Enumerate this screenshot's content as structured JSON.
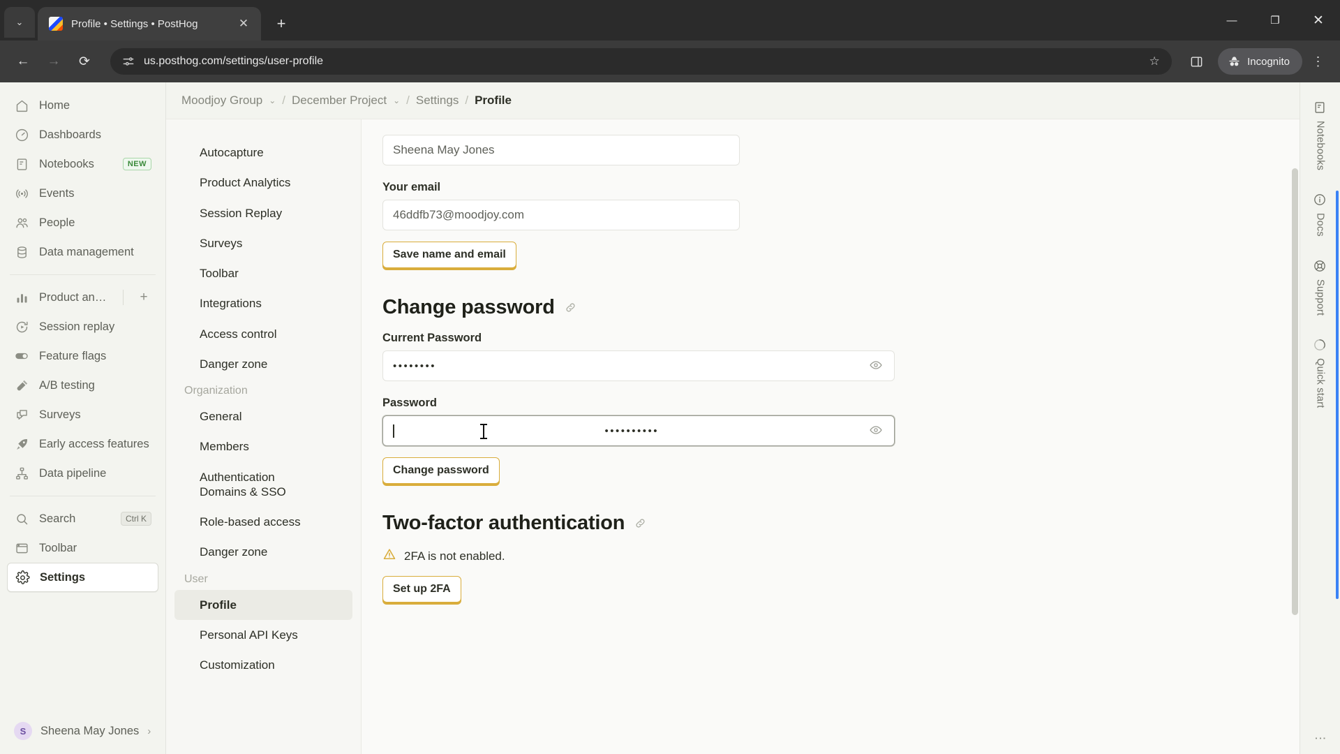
{
  "browser": {
    "tab": {
      "title": "Profile • Settings • PostHog",
      "favicon_name": "posthog-favicon",
      "close_label": "✕"
    },
    "new_tab_label": "+",
    "tab_list_chevron": "⌄",
    "window_controls": {
      "minimize": "—",
      "maximize": "❐",
      "close": "✕"
    },
    "nav": {
      "back": "←",
      "forward": "→",
      "reload": "⟳"
    },
    "omnibox": {
      "url": "us.posthog.com/settings/user-profile",
      "site_info_icon": "tune-icon",
      "star_label": "☆"
    },
    "side_panel_label": "side-panel",
    "incognito_label": "Incognito",
    "menu_label": "⋮"
  },
  "sidebar": {
    "primary": [
      {
        "label": "Home",
        "icon": "home-icon"
      },
      {
        "label": "Dashboards",
        "icon": "gauge-icon"
      },
      {
        "label": "Notebooks",
        "icon": "notebook-icon",
        "badge": "NEW"
      },
      {
        "label": "Events",
        "icon": "broadcast-icon"
      },
      {
        "label": "People",
        "icon": "people-icon"
      },
      {
        "label": "Data management",
        "icon": "database-icon"
      }
    ],
    "secondary": [
      {
        "label": "Product analytics",
        "icon": "bar-chart-icon",
        "has_plus": true
      },
      {
        "label": "Session replay",
        "icon": "replay-icon"
      },
      {
        "label": "Feature flags",
        "icon": "toggle-icon"
      },
      {
        "label": "A/B testing",
        "icon": "flask-icon"
      },
      {
        "label": "Surveys",
        "icon": "chat-icon"
      },
      {
        "label": "Early access features",
        "icon": "rocket-icon"
      },
      {
        "label": "Data pipeline",
        "icon": "pipeline-icon"
      }
    ],
    "tertiary": [
      {
        "label": "Search",
        "icon": "search-icon",
        "shortcut": "Ctrl K"
      },
      {
        "label": "Toolbar",
        "icon": "toolbar-icon"
      },
      {
        "label": "Settings",
        "icon": "gear-icon",
        "active": true
      }
    ],
    "user": {
      "name": "Sheena May Jones",
      "initial": "S",
      "chevron": "›"
    }
  },
  "settings_nav": {
    "items": [
      {
        "label": "Autocapture"
      },
      {
        "label": "Product Analytics"
      },
      {
        "label": "Session Replay"
      },
      {
        "label": "Surveys"
      },
      {
        "label": "Toolbar"
      },
      {
        "label": "Integrations"
      },
      {
        "label": "Access control"
      },
      {
        "label": "Danger zone"
      }
    ],
    "organization_header": "Organization",
    "organization_items": [
      {
        "label": "General"
      },
      {
        "label": "Members"
      },
      {
        "label": "Authentication Domains & SSO"
      },
      {
        "label": "Role-based access"
      },
      {
        "label": "Danger zone"
      }
    ],
    "user_header": "User",
    "user_items": [
      {
        "label": "Profile",
        "active": true
      },
      {
        "label": "Personal API Keys"
      },
      {
        "label": "Customization"
      }
    ]
  },
  "breadcrumb": {
    "org": "Moodjoy Group",
    "project": "December Project",
    "settings": "Settings",
    "current": "Profile",
    "separator": "/",
    "chevron": "⌄"
  },
  "main": {
    "name_value": "Sheena May Jones",
    "email_label": "Your email",
    "email_value": "46ddfb73@moodjoy.com",
    "save_button": "Save name and email",
    "change_password": {
      "title": "Change password",
      "link_icon": "link-icon",
      "current_label": "Current Password",
      "current_value": "••••••••",
      "new_label": "Password",
      "new_value": "••••••••••",
      "reveal_icon": "eye-icon",
      "button": "Change password"
    },
    "two_factor": {
      "title": "Two-factor authentication",
      "link_icon": "link-icon",
      "warning_icon": "warning-triangle-icon",
      "status": "2FA is not enabled.",
      "button": "Set up 2FA"
    }
  },
  "right_rail": {
    "items": [
      {
        "label": "Notebooks",
        "icon": "notebook-icon"
      },
      {
        "label": "Docs",
        "icon": "info-icon"
      },
      {
        "label": "Support",
        "icon": "support-icon"
      },
      {
        "label": "Quick start",
        "icon": "progress-icon"
      }
    ],
    "menu": "⋮"
  },
  "colors": {
    "accent_gold": "#d9ad3c",
    "nav_bg": "#f3f4ef",
    "content_bg": "#fafaf8",
    "badge_green": "#3a8a3a",
    "scroll_blue": "#3b82f6"
  }
}
